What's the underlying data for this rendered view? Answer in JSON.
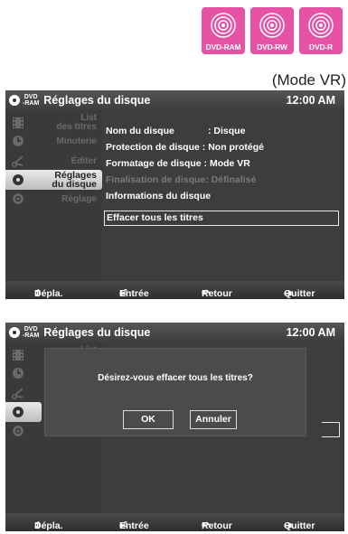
{
  "badges": [
    {
      "label": "DVD-RAM"
    },
    {
      "label": "DVD-RW"
    },
    {
      "label": "DVD-R"
    }
  ],
  "mode_label": "(Mode VR)",
  "screen": {
    "dvd_line1": "DVD",
    "dvd_line2": "-RAM",
    "title": "Réglages du disque",
    "clock": "12:00 AM",
    "sidebar": [
      {
        "line1": "List",
        "line2": "des titres",
        "icon": "film-icon"
      },
      {
        "label": "Minuterie",
        "icon": "timer-icon"
      },
      {
        "label": "Éditer",
        "icon": "scissors-icon"
      },
      {
        "line1": "Réglages",
        "line2": "du disque",
        "icon": "disc-icon"
      },
      {
        "label": "Réglage",
        "icon": "gear-icon"
      }
    ],
    "menu": [
      {
        "key": "Nom du disque",
        "value": ": Disque"
      },
      {
        "key": "Protection de disque",
        "value": ": Non protégé"
      },
      {
        "key": "Formatage de disque",
        "value": ": Mode VR"
      },
      {
        "key": "Finalisation de disque",
        "value": ": Définalisé"
      },
      {
        "key": "Informations du disque"
      },
      {
        "key": "Effacer tous les titres"
      }
    ],
    "footer": {
      "move": "Dépla.",
      "enter": "Entrée",
      "back": "Retour",
      "quit": "Quitter"
    }
  },
  "dialog": {
    "question": "Désirez-vous effacer tous les titres?",
    "ok": "OK",
    "cancel": "Annuler"
  },
  "colors": {
    "badge": "#e653a4",
    "screen_bg": "#3a3a3a",
    "highlight": "#d6d6d6"
  }
}
